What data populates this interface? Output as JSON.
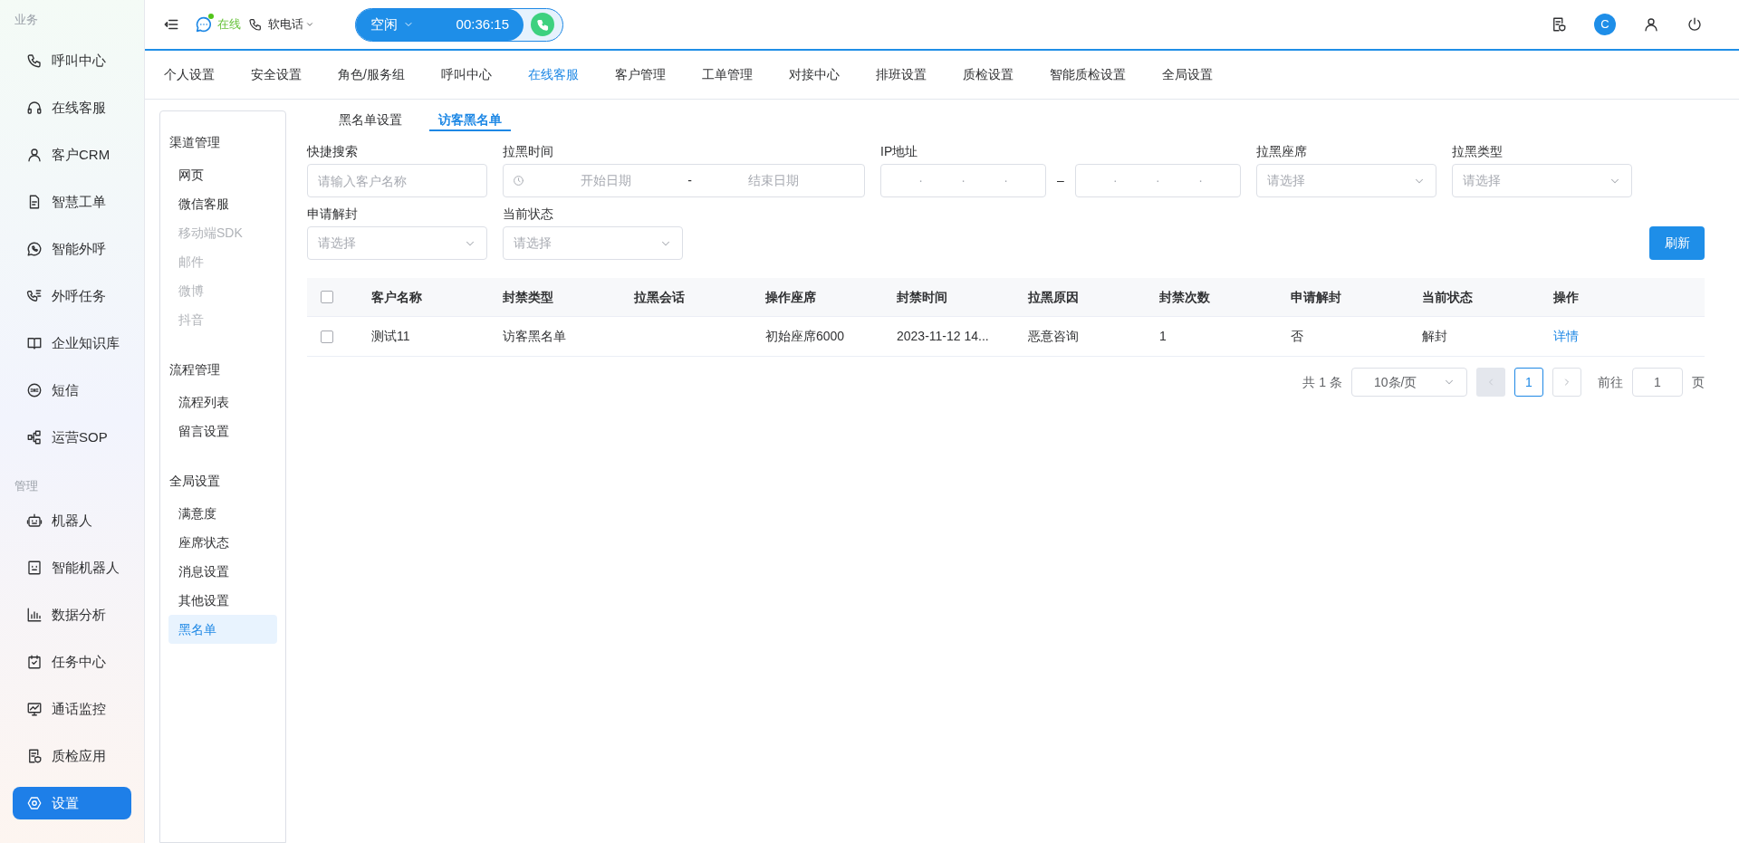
{
  "sidebar": {
    "sections": [
      {
        "title": "业务",
        "items": [
          {
            "label": "呼叫中心",
            "selected": false
          },
          {
            "label": "在线客服",
            "selected": false
          },
          {
            "label": "客户CRM",
            "selected": false
          },
          {
            "label": "智慧工单",
            "selected": false
          },
          {
            "label": "智能外呼",
            "selected": false
          },
          {
            "label": "外呼任务",
            "selected": false
          },
          {
            "label": "企业知识库",
            "selected": false
          },
          {
            "label": "短信",
            "selected": false
          },
          {
            "label": "运营SOP",
            "selected": false
          }
        ]
      },
      {
        "title": "管理",
        "items": [
          {
            "label": "机器人",
            "selected": false
          },
          {
            "label": "智能机器人",
            "selected": false
          },
          {
            "label": "数据分析",
            "selected": false
          },
          {
            "label": "任务中心",
            "selected": false
          },
          {
            "label": "通话监控",
            "selected": false
          },
          {
            "label": "质检应用",
            "selected": false
          },
          {
            "label": "设置",
            "selected": true
          }
        ]
      }
    ]
  },
  "topbar": {
    "presence": "在线",
    "phone_mode": "软电话",
    "status": "空闲",
    "timer": "00:36:15",
    "avatar_letter": "C"
  },
  "nav_tabs": [
    {
      "label": "个人设置",
      "selected": false
    },
    {
      "label": "安全设置",
      "selected": false
    },
    {
      "label": "角色/服务组",
      "selected": false
    },
    {
      "label": "呼叫中心",
      "selected": false
    },
    {
      "label": "在线客服",
      "selected": true
    },
    {
      "label": "客户管理",
      "selected": false
    },
    {
      "label": "工单管理",
      "selected": false
    },
    {
      "label": "对接中心",
      "selected": false
    },
    {
      "label": "排班设置",
      "selected": false
    },
    {
      "label": "质检设置",
      "selected": false
    },
    {
      "label": "智能质检设置",
      "selected": false
    },
    {
      "label": "全局设置",
      "selected": false
    }
  ],
  "settings_menu": [
    {
      "title": "渠道管理",
      "items": [
        {
          "label": "网页",
          "disabled": false,
          "selected": false
        },
        {
          "label": "微信客服",
          "disabled": false,
          "selected": false
        },
        {
          "label": "移动端SDK",
          "disabled": true,
          "selected": false
        },
        {
          "label": "邮件",
          "disabled": true,
          "selected": false
        },
        {
          "label": "微博",
          "disabled": true,
          "selected": false
        },
        {
          "label": "抖音",
          "disabled": true,
          "selected": false
        }
      ]
    },
    {
      "title": "流程管理",
      "items": [
        {
          "label": "流程列表",
          "disabled": false,
          "selected": false
        },
        {
          "label": "留言设置",
          "disabled": false,
          "selected": false
        }
      ]
    },
    {
      "title": "全局设置",
      "items": [
        {
          "label": "满意度",
          "disabled": false,
          "selected": false
        },
        {
          "label": "座席状态",
          "disabled": false,
          "selected": false
        },
        {
          "label": "消息设置",
          "disabled": false,
          "selected": false
        },
        {
          "label": "其他设置",
          "disabled": false,
          "selected": false
        },
        {
          "label": "黑名单",
          "disabled": false,
          "selected": true
        }
      ]
    }
  ],
  "sub_tabs": [
    {
      "label": "黑名单设置",
      "selected": false
    },
    {
      "label": "访客黑名单",
      "selected": true
    }
  ],
  "filters": [
    {
      "kind": "text",
      "label": "快捷搜索",
      "placeholder": "请输入客户名称"
    },
    {
      "kind": "daterange",
      "label": "拉黑时间",
      "start_placeholder": "开始日期",
      "separator": "-",
      "end_placeholder": "结束日期"
    },
    {
      "kind": "iprange",
      "label": "IP地址",
      "separator": "–",
      "from_dots": [
        "·",
        "·",
        "·"
      ],
      "to_dots": [
        "·",
        "·",
        "·"
      ]
    },
    {
      "kind": "select",
      "label": "拉黑座席",
      "placeholder": "请选择"
    },
    {
      "kind": "select",
      "label": "拉黑类型",
      "placeholder": "请选择"
    },
    {
      "kind": "select",
      "label": "申请解封",
      "placeholder": "请选择"
    },
    {
      "kind": "select",
      "label": "当前状态",
      "placeholder": "请选择"
    }
  ],
  "refresh_button": "刷新",
  "table": {
    "header_checked": false,
    "columns": [
      "客户名称",
      "封禁类型",
      "拉黑会话",
      "操作座席",
      "封禁时间",
      "拉黑原因",
      "封禁次数",
      "申请解封",
      "当前状态",
      "操作"
    ],
    "rows": [
      {
        "checked": false,
        "cells": [
          "测试11",
          "访客黑名单",
          "",
          "初始座席6000",
          "2023-11-12 14...",
          "恶意咨询",
          "1",
          "否",
          "解封"
        ],
        "action": "详情"
      }
    ]
  },
  "pagination": {
    "total": "共 1 条",
    "page_size": "10条/页",
    "pages": [
      {
        "label": "1",
        "selected": true
      }
    ],
    "prev_disabled": true,
    "next_disabled": false,
    "goto_label": "前往",
    "goto_value": "1",
    "goto_suffix": "页"
  }
}
